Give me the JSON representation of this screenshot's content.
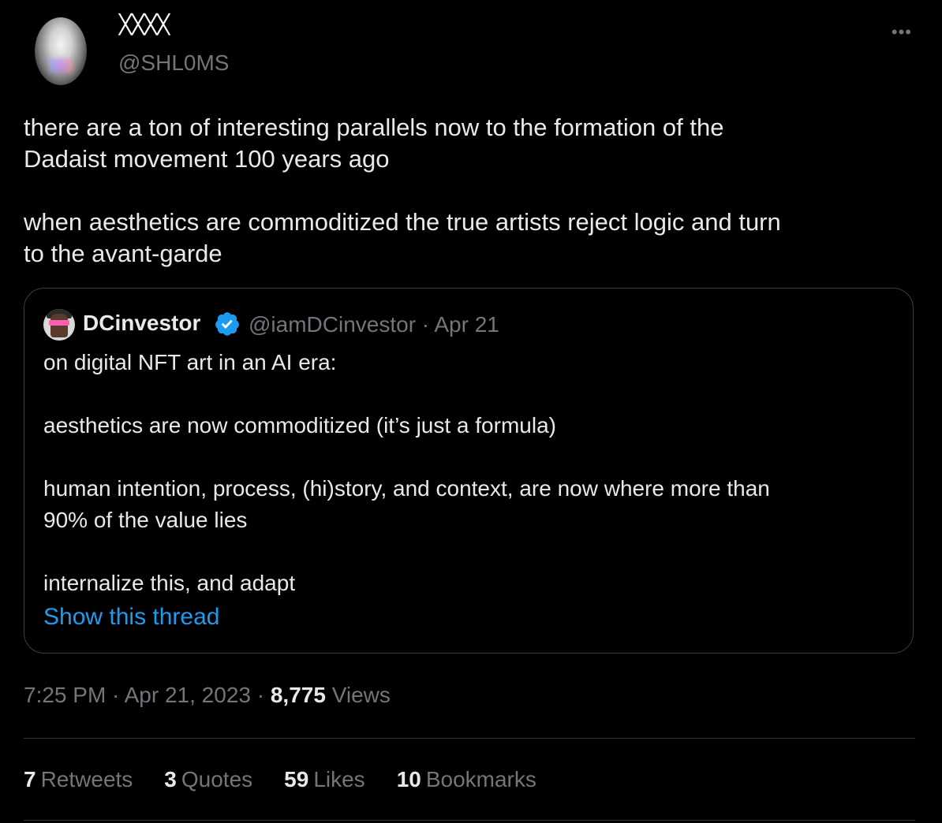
{
  "author": {
    "display_name": "ᚷᚷᚷᚷ",
    "handle": "@SHL0MS"
  },
  "more_icon": "ellipsis-icon",
  "tweet": {
    "text": "there are a ton of interesting parallels now to the formation of the\nDadaist movement 100 years ago\n\nwhen aesthetics are commoditized the true artists reject logic and turn\nto the avant-garde"
  },
  "quote": {
    "name": "DCinvestor",
    "verified_icon": "verified-badge-icon",
    "meta": "@iamDCinvestor · Apr 21",
    "text": "on digital NFT art in an AI era:\n\naesthetics are now commoditized (it’s just a formula)\n\nhuman intention, process, (hi)story, and context, are now where more than\n90% of the value lies\n\ninternalize this, and adapt",
    "show_thread": "Show this thread"
  },
  "timestamp": {
    "time_date": "7:25 PM · Apr 21, 2023 · ",
    "views_count": "8,775",
    "views_label": " Views"
  },
  "stats": [
    {
      "num": "7",
      "label": "Retweets"
    },
    {
      "num": "3",
      "label": "Quotes"
    },
    {
      "num": "59",
      "label": "Likes"
    },
    {
      "num": "10",
      "label": "Bookmarks"
    }
  ],
  "colors": {
    "background": "#000000",
    "text": "#e7e9ea",
    "muted": "#71767b",
    "link": "#1d9bf0",
    "border": "#3a3d41"
  }
}
